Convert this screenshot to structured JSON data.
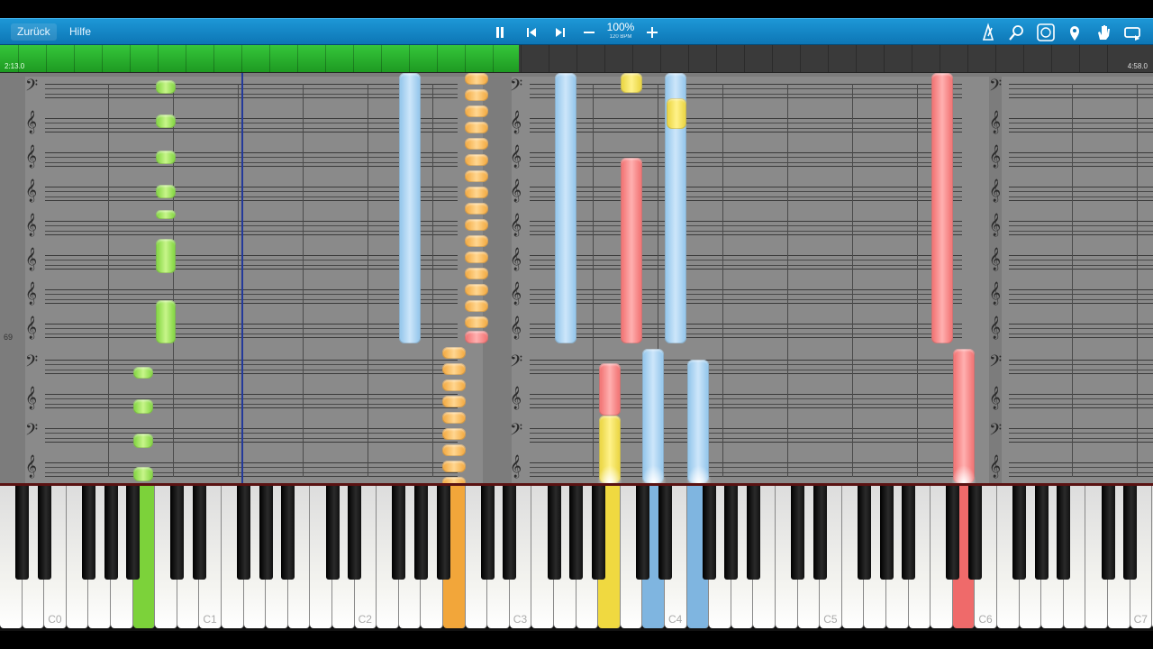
{
  "toolbar": {
    "back_label": "Zurück",
    "help_label": "Hilfe",
    "pause_icon": "pause-icon",
    "prev_icon": "skip-back-icon",
    "next_icon": "skip-forward-icon",
    "minus_icon": "minus-icon",
    "plus_icon": "plus-icon",
    "zoom_value": "100%",
    "tempo_value": "120 BPM",
    "right_icons": [
      "metronome-icon",
      "search-icon",
      "loop-icon",
      "location-pin-icon",
      "hand-icon",
      "repeat-icon"
    ]
  },
  "timeline": {
    "current_time": "2:13.0",
    "total_time": "4:58.0",
    "progress": 0.45
  },
  "sheet": {
    "measure_number": "69"
  },
  "keyboard": {
    "octave_labels": [
      "C0",
      "C1",
      "C2",
      "C3",
      "C4",
      "C5",
      "C6",
      "C7"
    ],
    "colors": {
      "blue": "#7fb5e0",
      "red": "#ef6a6a",
      "yellow": "#f0d940",
      "green": "#7cd23a",
      "orange": "#f2a63a"
    }
  }
}
